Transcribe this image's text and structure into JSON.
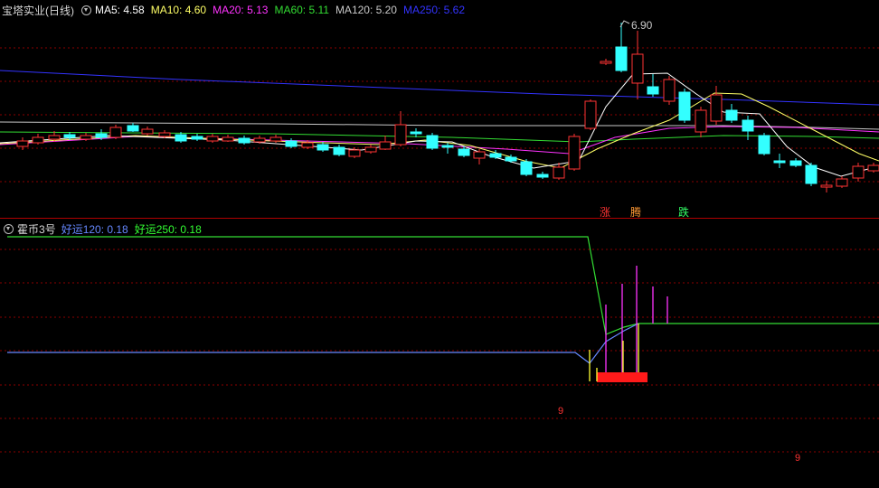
{
  "top": {
    "title": "宝塔实业(日线)",
    "ma": [
      {
        "label": "MA5: 4.58",
        "color": "#ffffff"
      },
      {
        "label": "MA10: 4.60",
        "color": "#ffff66"
      },
      {
        "label": "MA20: 5.13",
        "color": "#ff33ff"
      },
      {
        "label": "MA60: 5.11",
        "color": "#33dd33"
      },
      {
        "label": "MA120: 5.20",
        "color": "#c8c8c8"
      },
      {
        "label": "MA250: 5.62",
        "color": "#3333ff"
      }
    ],
    "peak_label": "6.90",
    "signals": [
      {
        "text": "涨",
        "color": "#ff3333"
      },
      {
        "text": "腾",
        "color": "#ff9933"
      },
      {
        "text": "跌",
        "color": "#33ff66"
      }
    ]
  },
  "bottom": {
    "title": "霍币3号",
    "items": [
      {
        "label": "好运120: 0.18",
        "color": "#6688ff"
      },
      {
        "label": "好运250: 0.18",
        "color": "#33ff33"
      }
    ],
    "marks": [
      "9",
      "9"
    ]
  },
  "colors": {
    "up": "#ff3333",
    "down": "#33ffff",
    "grid": "#8a0000",
    "separator": "#b00000"
  }
}
